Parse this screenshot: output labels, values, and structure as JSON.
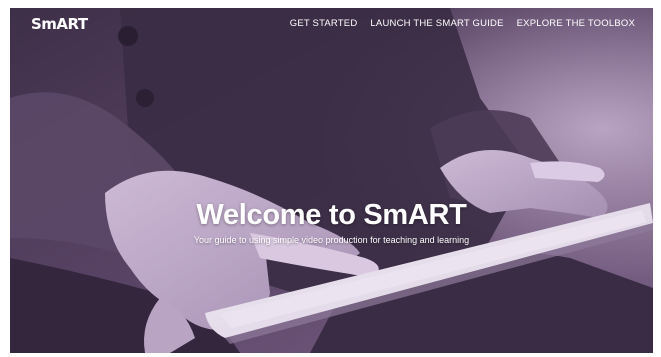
{
  "brand": {
    "logo_text": "SmART",
    "logo_icon": "figure-icon"
  },
  "nav": {
    "items": [
      {
        "label": "GET STARTED"
      },
      {
        "label": "LAUNCH THE SMART GUIDE"
      },
      {
        "label": "EXPLORE THE TOOLBOX"
      }
    ]
  },
  "hero": {
    "title": "Welcome to SmART",
    "subtitle": "Your guide to using simple video production for teaching and learning",
    "image_subject": "hands-holding-tablet-photo",
    "overlay_color": "#6b4f7a"
  }
}
